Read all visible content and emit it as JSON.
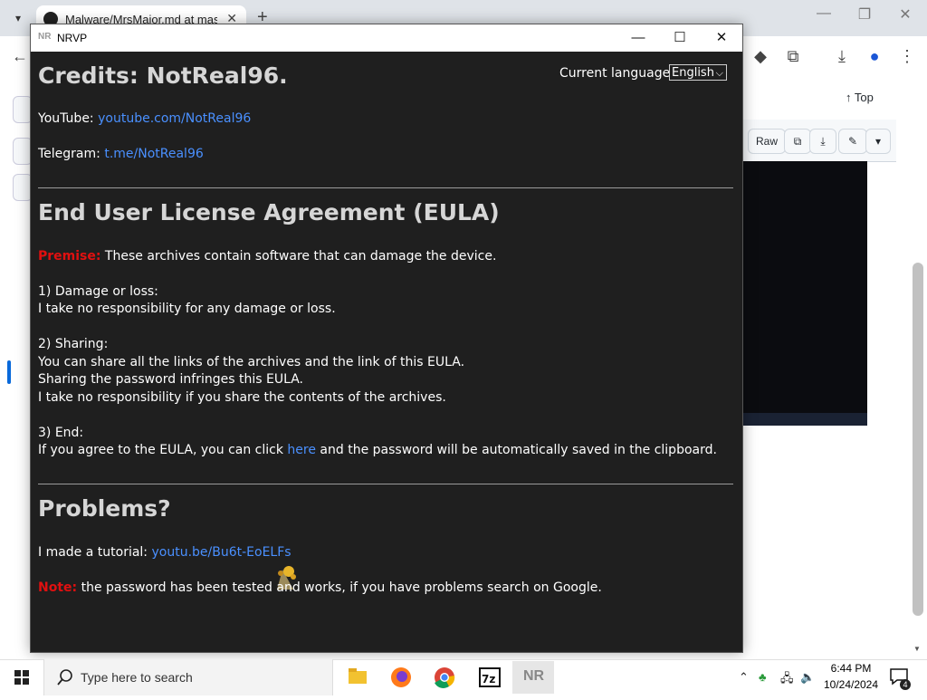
{
  "browser": {
    "tab_title": "Malware/MrsMajor.md at master",
    "top_link": "Top",
    "raw_label": "Raw"
  },
  "window": {
    "title": "NRVP",
    "logo": "NR"
  },
  "language": {
    "label": "Current language:",
    "selected": "English"
  },
  "credits": {
    "heading": "Credits: NotReal96.",
    "youtube_label": "YouTube:",
    "youtube_link": "youtube.com/NotReal96",
    "telegram_label": "Telegram:",
    "telegram_link": "t.me/NotReal96"
  },
  "eula": {
    "heading": "End User License Agreement (EULA)",
    "premise_label": "Premise:",
    "premise_text": " These archives contain software that can damage the device.",
    "s1_title": "1) Damage or loss:",
    "s1_line1": "I take no responsibility for any damage or loss.",
    "s2_title": "2) Sharing:",
    "s2_line1": "You can share all the links of the archives and the link of this EULA.",
    "s2_line2": "Sharing the password infringes this EULA.",
    "s2_line3": "I take no responsibility if you share the contents of the archives.",
    "s3_title": "3) End:",
    "s3_pre": "If you agree to the EULA, you can click ",
    "s3_link": "here",
    "s3_post": " and the password will be automatically saved in the clipboard."
  },
  "problems": {
    "heading": "Problems?",
    "tutorial_label": "I made a tutorial: ",
    "tutorial_link": "youtu.be/Bu6t-EoELFs",
    "note_label": "Note:",
    "note_text": " the password has been tested and works, if you have problems search on Google."
  },
  "taskbar": {
    "search_placeholder": "Type here to search",
    "time": "6:44 PM",
    "date": "10/24/2024",
    "notification_count": "4",
    "active_app_label": "NR"
  },
  "colors": {
    "window_bg": "#1f1f1f",
    "heading": "#d6d6d6",
    "link": "#4a90ff",
    "warning": "#e01010"
  },
  "icons": [
    "github-icon",
    "windows-start-icon",
    "search-icon",
    "file-explorer-icon",
    "firefox-icon",
    "chrome-icon",
    "7zip-icon",
    "nr-app-icon",
    "chevron-up-icon",
    "network-icon",
    "volume-icon",
    "notification-icon",
    "minimize-icon",
    "maximize-icon",
    "close-icon"
  ]
}
